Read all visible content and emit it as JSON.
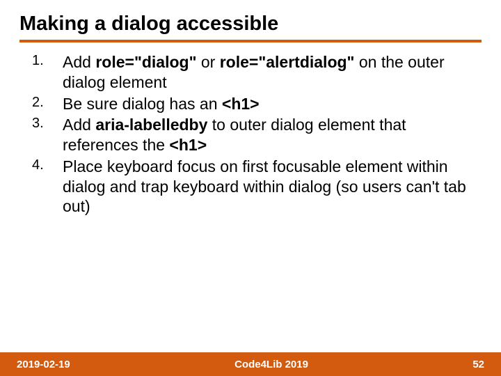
{
  "title": "Making a dialog accessible",
  "items": [
    {
      "segments": [
        {
          "text": "Add ",
          "bold": false
        },
        {
          "text": "role=\"dialog\"",
          "bold": true
        },
        {
          "text": " or ",
          "bold": false
        },
        {
          "text": "role=\"alertdialog\"",
          "bold": true
        },
        {
          "text": " on the outer dialog element",
          "bold": false
        }
      ]
    },
    {
      "segments": [
        {
          "text": "Be sure dialog has an ",
          "bold": false
        },
        {
          "text": "<h1>",
          "bold": true
        }
      ]
    },
    {
      "segments": [
        {
          "text": "Add ",
          "bold": false
        },
        {
          "text": "aria-labelledby",
          "bold": true
        },
        {
          "text": " to outer dialog element that references the ",
          "bold": false
        },
        {
          "text": "<h1>",
          "bold": true
        }
      ]
    },
    {
      "segments": [
        {
          "text": "Place keyboard focus on first focusable element within dialog and trap keyboard within dialog (so users can't tab out)",
          "bold": false
        }
      ]
    }
  ],
  "footer": {
    "date": "2019-02-19",
    "event": "Code4Lib 2019",
    "page": "52"
  }
}
